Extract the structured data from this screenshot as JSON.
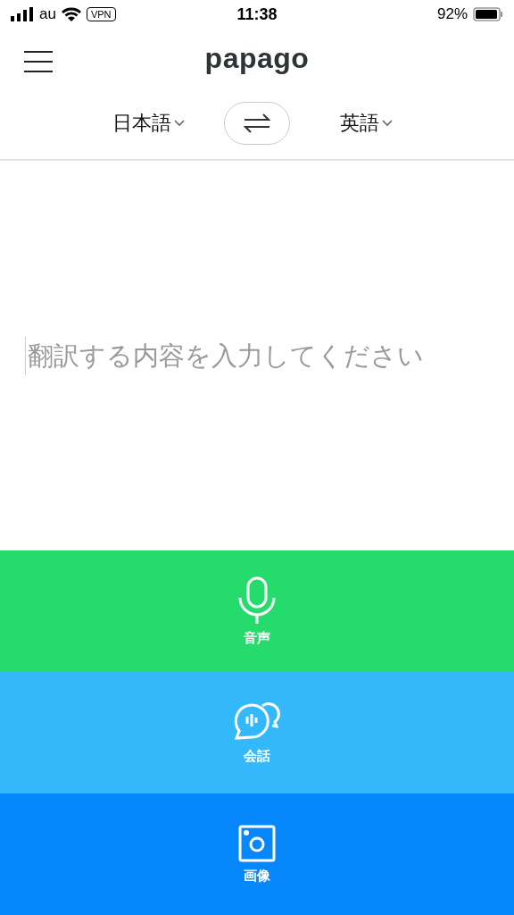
{
  "status_bar": {
    "carrier": "au",
    "vpn": "VPN",
    "time": "11:38",
    "battery": "92%"
  },
  "header": {
    "logo": "papago"
  },
  "languages": {
    "source": "日本語",
    "target": "英語"
  },
  "input": {
    "placeholder": "翻訳する内容を入力してください"
  },
  "modes": [
    {
      "kind": "voice",
      "label": "音声",
      "color": "#24db6c"
    },
    {
      "kind": "conversation",
      "label": "会話",
      "color": "#33b9fb"
    },
    {
      "kind": "image",
      "label": "画像",
      "color": "#0787fc"
    }
  ]
}
